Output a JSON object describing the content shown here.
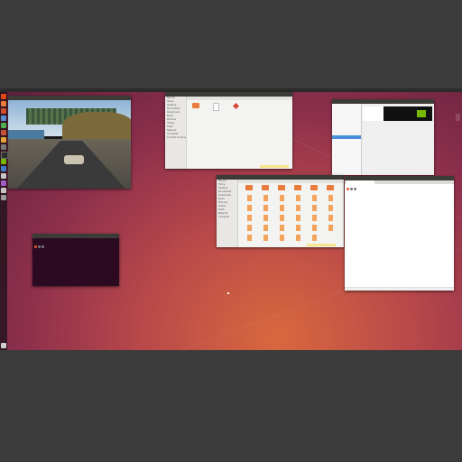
{
  "topbar": {
    "title": "",
    "right": ""
  },
  "game_window": {
    "title": "",
    "overlay_label": ""
  },
  "files_window_1": {
    "title": "",
    "sidebar": [
      "Recent",
      "Home",
      "Desktop",
      "Documents",
      "Downloads",
      "Music",
      "Pictures",
      "Videos",
      "Trash",
      "Network",
      "Computer",
      "Connect to Server"
    ],
    "items": [
      {
        "type": "folder",
        "label": ""
      },
      {
        "type": "file",
        "label": ""
      },
      {
        "type": "star",
        "label": ""
      }
    ],
    "status": ""
  },
  "files_window_2": {
    "title": "",
    "sidebar": [
      "Recent",
      "Home",
      "Desktop",
      "Documents",
      "Downloads",
      "Music",
      "Pictures",
      "Videos",
      "Trash",
      "Network",
      "Computer"
    ],
    "item_count": 35,
    "status": ""
  },
  "nvidia_window": {
    "title": "",
    "sidebar": [
      "",
      "",
      "",
      "",
      "",
      "",
      "",
      "",
      "",
      "",
      "",
      ""
    ],
    "rows": [
      "",
      "",
      "",
      ""
    ]
  },
  "editor_window": {
    "title": "",
    "tab": "",
    "lines": [
      "",
      "",
      "",
      "",
      "",
      "",
      "",
      "",
      "",
      "",
      "",
      ""
    ]
  },
  "terminal_window": {
    "title": "",
    "lines": [
      "",
      "",
      "",
      "",
      "",
      "",
      "",
      "",
      "",
      "",
      "",
      "",
      "",
      "",
      "",
      "",
      "",
      ""
    ]
  },
  "colors": {
    "accent": "#e95420",
    "folder": "#e97b3c",
    "nvidia_green": "#76b900",
    "terminal_bg": "#2c0a22"
  }
}
